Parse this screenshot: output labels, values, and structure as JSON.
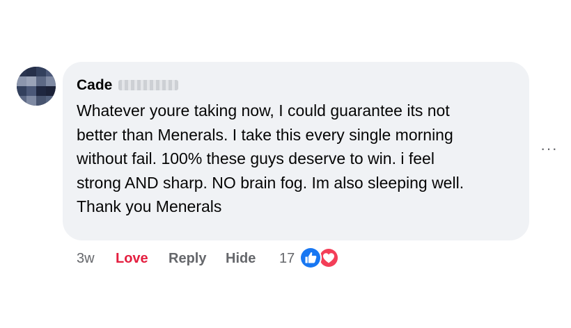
{
  "comment": {
    "author_first_name": "Cade",
    "author_last_name_redacted": true,
    "text_lines": [
      "Whatever youre taking now, I could guarantee its not",
      "better than Menerals. I take this every single morning",
      "without fail. 100% these guys deserve to win. i feel",
      "strong AND sharp. NO brain fog. Im also sleeping well.",
      "Thank you Menerals"
    ],
    "more_label": "···"
  },
  "actions": {
    "timestamp": "3w",
    "love_label": "Love",
    "reply_label": "Reply",
    "hide_label": "Hide",
    "reaction_count": "17",
    "reaction_icons": [
      "like-icon",
      "love-icon"
    ]
  },
  "colors": {
    "bubble": "#f0f2f5",
    "text": "#050505",
    "muted": "#65676b",
    "love": "#e41e3f",
    "like_blue": "#1877f2",
    "love_red": "#f33e58"
  }
}
